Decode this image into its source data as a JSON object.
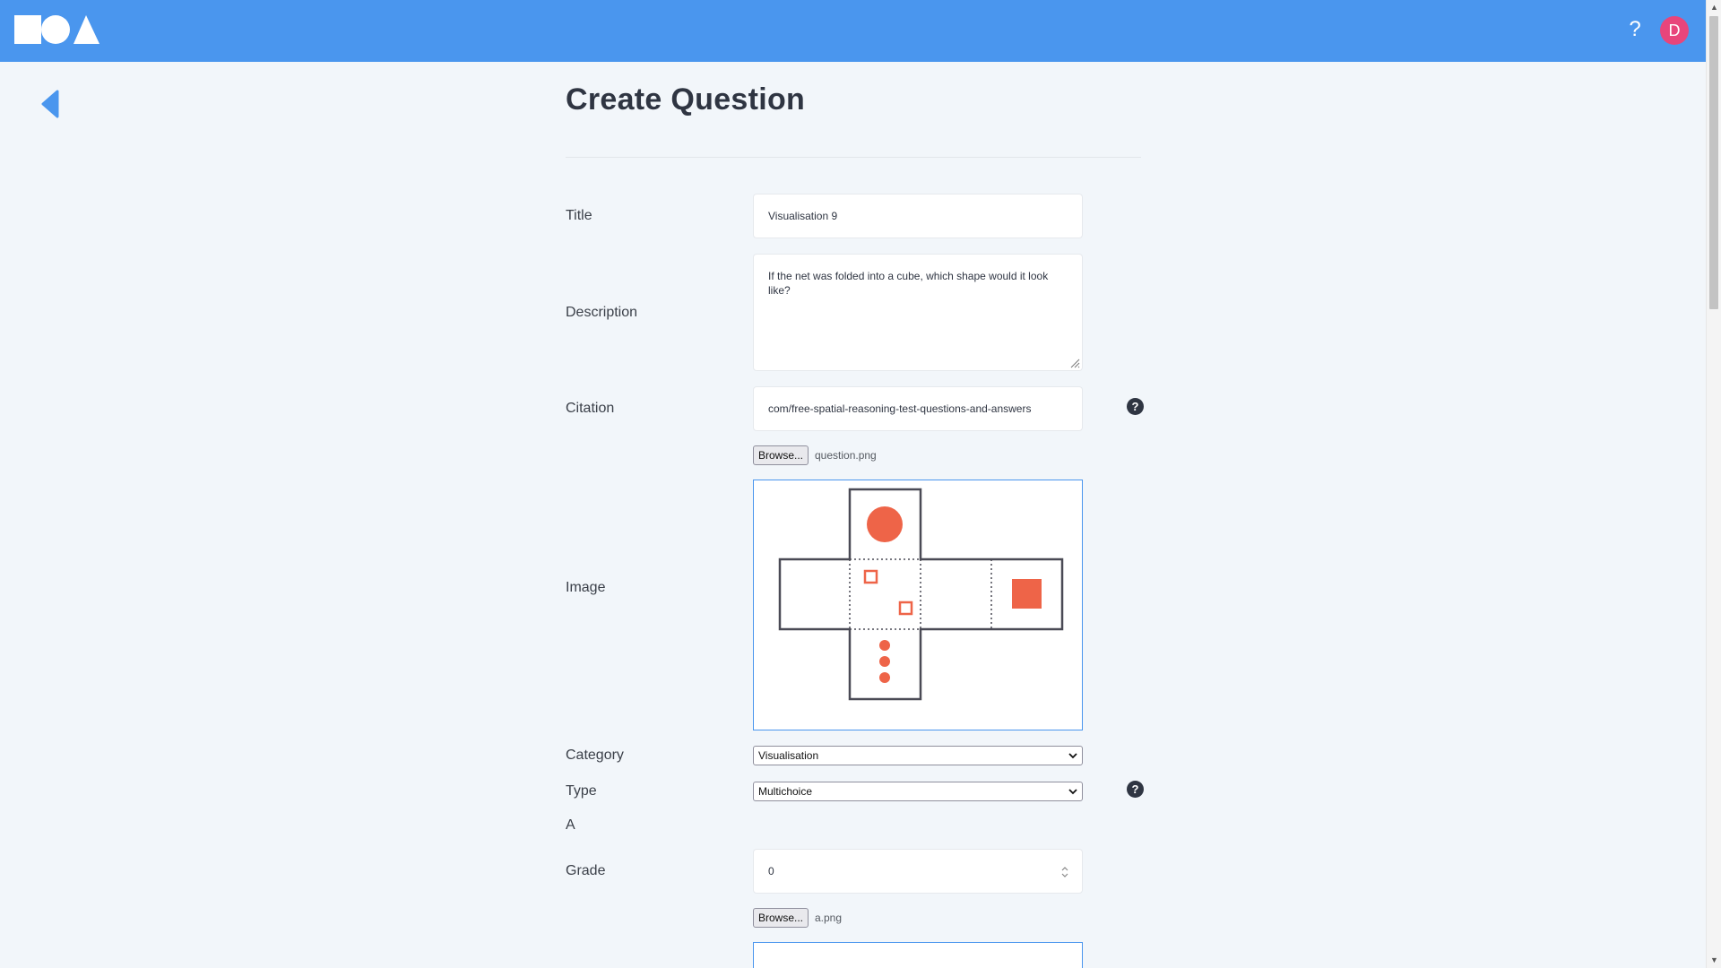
{
  "header": {
    "help_label": "?",
    "avatar_initial": "D",
    "brand_color": "#4a96ee",
    "avatar_color": "#e8457b"
  },
  "page": {
    "title": "Create Question"
  },
  "form": {
    "title_label": "Title",
    "title_value": "Visualisation 9",
    "description_label": "Description",
    "description_value": "If the net was folded into a cube, which shape would it look like?",
    "citation_label": "Citation",
    "citation_value": "com/free-spatial-reasoning-test-questions-and-answers",
    "question_browse_label": "Browse...",
    "question_file_name": "question.png",
    "image_label": "Image",
    "category_label": "Category",
    "category_value": "Visualisation",
    "type_label": "Type",
    "type_value": "Multichoice",
    "answer_section_label": "A",
    "grade_label": "Grade",
    "grade_value": "0",
    "answer_browse_label": "Browse...",
    "answer_file_name": "a.png",
    "help_glyph": "?"
  },
  "icons": {
    "back": "back-arrow-icon",
    "help": "question-circle-icon",
    "chevron": "chevron-down-icon"
  }
}
